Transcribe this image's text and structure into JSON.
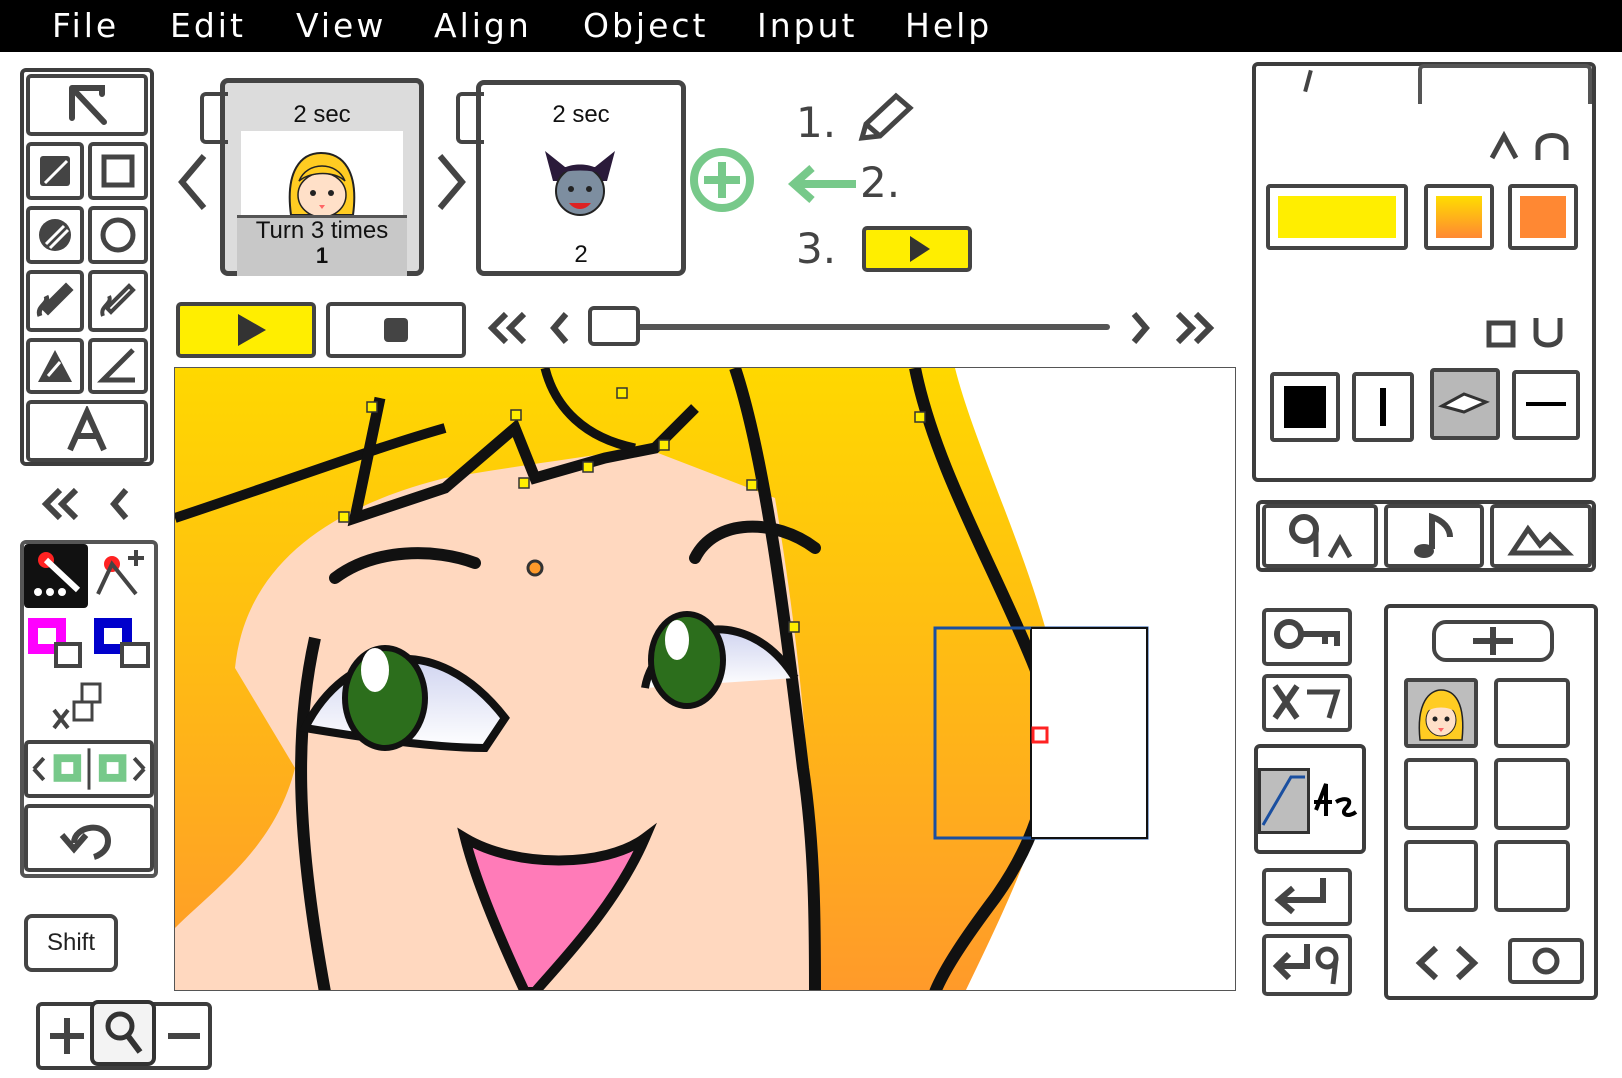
{
  "menu": [
    "File",
    "Edit",
    "View",
    "Align",
    "Object",
    "Input",
    "Help"
  ],
  "pages": [
    {
      "duration": "2 sec",
      "action": "Turn 3 times",
      "number": "1",
      "selected": true
    },
    {
      "duration": "2 sec",
      "number": "2",
      "selected": false
    }
  ],
  "steps": {
    "step1": "1.",
    "step2": "2.",
    "step3": "3."
  },
  "left_toolbar": {
    "shift_label": "Shift"
  },
  "colors": {
    "accent_yellow": "#ffee00",
    "orange": "#ff8833",
    "magenta": "#ff00ff",
    "blue": "#0000cc",
    "green_add": "#77c98a",
    "hair_top": "#ffd800",
    "hair_bottom": "#ff9a2a",
    "skin": "#ffd8bf"
  },
  "icons": [
    "select-arrow-icon",
    "rectangle-fill-icon",
    "rectangle-outline-icon",
    "ellipse-fill-icon",
    "ellipse-outline-icon",
    "pencil-fill-icon",
    "pencil-outline-icon",
    "triangle-fill-icon",
    "angle-icon",
    "text-icon",
    "rewind-icon",
    "back-icon",
    "add-point-icon",
    "undo-icon",
    "zoom-in-icon",
    "magnifier-icon",
    "zoom-out-icon",
    "sound-icon",
    "image-icon",
    "key-icon"
  ]
}
